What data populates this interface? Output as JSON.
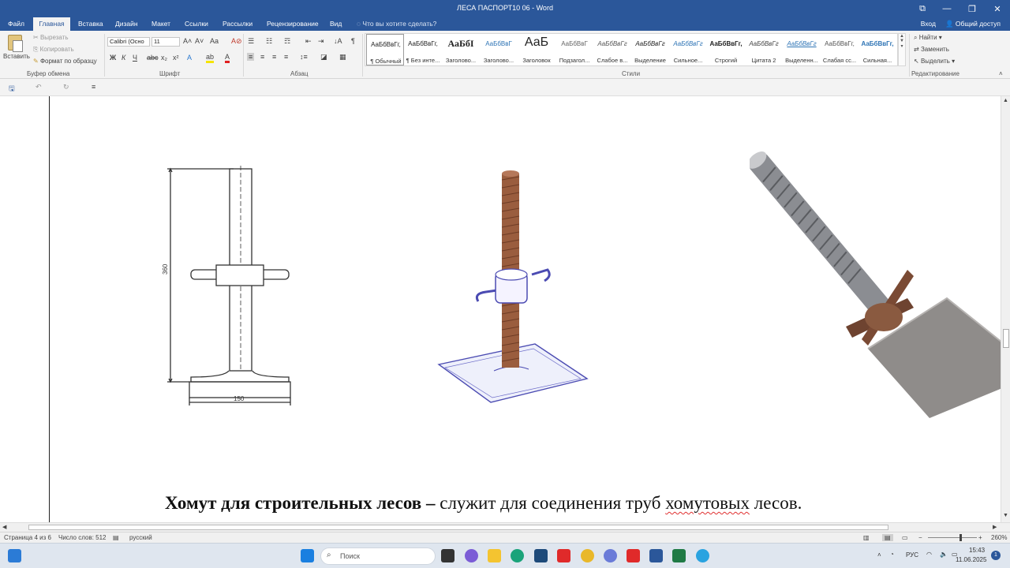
{
  "window": {
    "title": "ЛЕСА ПАСПОРТ10 06 - Word",
    "controls": {
      "mode": "⧉",
      "minimize": "—",
      "restore": "❐",
      "close": "✕"
    }
  },
  "tabs": [
    "Файл",
    "Главная",
    "Вставка",
    "Дизайн",
    "Макет",
    "Ссылки",
    "Рассылки",
    "Рецензирование",
    "Вид"
  ],
  "tell_me": "Что вы хотите сделать?",
  "account": {
    "signin": "Вход",
    "share": "Общий доступ"
  },
  "ribbon": {
    "clipboard": {
      "paste": "Вставить",
      "cut": "Вырезать",
      "copy": "Копировать",
      "format_painter": "Формат по образцу",
      "label": "Буфер обмена"
    },
    "font": {
      "name": "Calibri (Осно",
      "size": "11",
      "label": "Шрифт",
      "bold": "Ж",
      "italic": "К",
      "underline": "Ч",
      "strike": "abc",
      "subscript": "x₂",
      "superscript": "x²",
      "grow": "A˄",
      "shrink": "A˅",
      "case": "Aa",
      "clear": "A⊘",
      "effects": "A",
      "highlight": "ab",
      "color": "A"
    },
    "paragraph": {
      "label": "Абзац",
      "pilcrow": "¶",
      "sort": "↓A"
    },
    "styles": {
      "label": "Стили",
      "items": [
        {
          "sample": "АаБбВвГг,",
          "name": "¶ Обычный"
        },
        {
          "sample": "АаБбВвГг,",
          "name": "¶ Без инте..."
        },
        {
          "sample": "АаБбI",
          "name": "Заголово..."
        },
        {
          "sample": "АаБбВвГ",
          "name": "Заголово..."
        },
        {
          "sample": "АаБ",
          "name": "Заголовок"
        },
        {
          "sample": "АаБбВвГ",
          "name": "Подзагол..."
        },
        {
          "sample": "АаБбВвГг",
          "name": "Слабое в..."
        },
        {
          "sample": "АаБбВвГг",
          "name": "Выделение"
        },
        {
          "sample": "АаБбВвГг",
          "name": "Сильное..."
        },
        {
          "sample": "АаБбВвГг,",
          "name": "Строгий"
        },
        {
          "sample": "АаБбВвГг",
          "name": "Цитата 2"
        },
        {
          "sample": "АаБбВвГг",
          "name": "Выделенн..."
        },
        {
          "sample": "АаБбВвГг,",
          "name": "Слабая сс..."
        },
        {
          "sample": "АаБбВвГг,",
          "name": "Сильная..."
        }
      ]
    },
    "editing": {
      "find": "Найти",
      "replace": "Заменить",
      "select": "Выделить",
      "label": "Редактирование"
    }
  },
  "document": {
    "caption_bold": "Хомут для строительных лесов –",
    "caption_normal": " служит для соединения труб ",
    "caption_spell": "хомутовых",
    "caption_end": " лесов.",
    "drawing_dim_height": "360",
    "drawing_dim_width": "150"
  },
  "status": {
    "page": "Страница 4 из 6",
    "words": "Число слов: 512",
    "language": "русский",
    "zoom": "260%"
  },
  "taskbar": {
    "search": "Поиск",
    "lang": "РУС",
    "time": "15:43",
    "date": "11.06.2025",
    "notif": "1"
  },
  "colors": {
    "word_blue": "#2b579a",
    "thread_rust": "#9a5d3e",
    "plate_outline": "#4b4bb2"
  }
}
